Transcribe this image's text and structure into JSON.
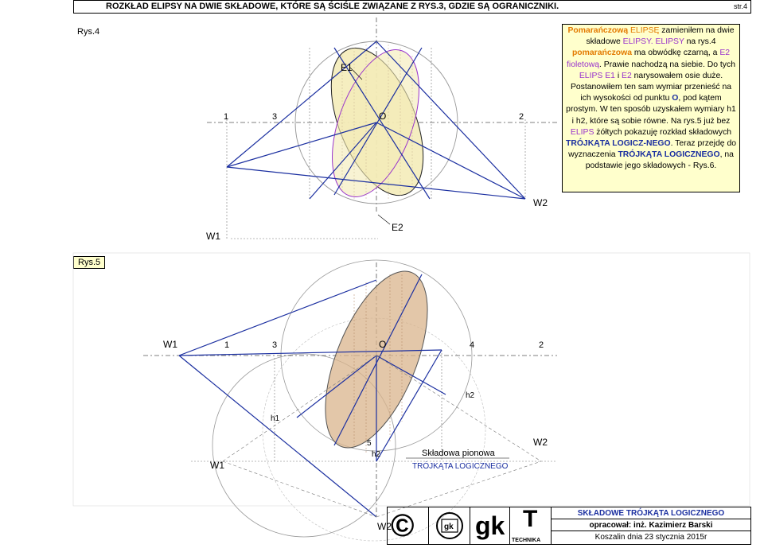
{
  "header": {
    "title": "ROZKŁAD ELIPSY NA DWIE SKŁADOWE, KTÓRE SĄ ŚCIŚLE ZWIĄZANE Z RYS.3, GDZIE SĄ OGRANICZNIKI.",
    "page": "str.4"
  },
  "rys4": {
    "tag": "Rys.4",
    "labels": {
      "l1": "1",
      "l3": "3",
      "O": "O",
      "l2": "2",
      "E1": "E1",
      "E2": "E2",
      "W1": "W1",
      "W2": "W2"
    }
  },
  "rys5": {
    "tag": "Rys.5",
    "labels": {
      "W1a": "W1",
      "l1": "1",
      "l3": "3",
      "O": "O",
      "l4": "4",
      "l2": "2",
      "h2a": "h2",
      "h1": "h1",
      "l5": "5",
      "W1b": "W1",
      "h2b": "h2",
      "W2a": "W2",
      "W2b": "W2",
      "caption1": "Składowa pionowa",
      "caption2": "TRÓJKĄTA LOGICZNEGO"
    }
  },
  "description": {
    "p1": "Pomarańczową",
    "p2": " ",
    "p3": "ELIPSĘ",
    "p4": " zamieniłem na dwie składowe ",
    "p5": "ELIPSY",
    "p6": ". ",
    "p7": "ELIPSY",
    "p8": " na rys.4 ",
    "p9": "pomarańczowa",
    "p10": " ma obwódkę czarną, a ",
    "p11": "E2",
    "p12": " ",
    "p13": "fioletową",
    "p14": ". Prawie nachodzą na siebie. Do tych ",
    "p15": "ELIPS",
    "p16": " ",
    "p17": "E1",
    "p18": " i ",
    "p19": "E2",
    "p20": " narysowałem osie duże. Postanowiłem ten sam wymiar przenieść na ich wysokości od punktu ",
    "p21": "O",
    "p22": ", pod kątem prostym. W ten sposób uzyskałem wymiary h1 i h2, które są sobie równe. Na rys.5 już bez ",
    "p23": "ELIPS",
    "p24": " żółtych pokazuję rozkład składowych ",
    "p25": "TRÓJKĄTA LOGICZ-NEGO",
    "p26": ". Teraz przejdę do wyznaczenia ",
    "p27": "TRÓJKĄTA LOGICZNEGO",
    "p28": ", na podstawie jego składowych - Rys.6."
  },
  "footer": {
    "copyright": "©",
    "logo": "gk",
    "gk": "gk",
    "t": "T",
    "technika": "TECHNIKA",
    "line1": "SKŁADOWE TRÓJKĄTA LOGICZNEGO",
    "line2": "opracował:  inż. Kazimierz Barski",
    "line3": "Koszalin dnia 23 stycznia 2015r"
  },
  "colors": {
    "accent_navy": "#1b2fa0",
    "orange": "#e37a00",
    "violet": "#9933cc",
    "ellipse_fill": "#f3ebb5",
    "ellipse5_fill": "#d9b48c"
  }
}
